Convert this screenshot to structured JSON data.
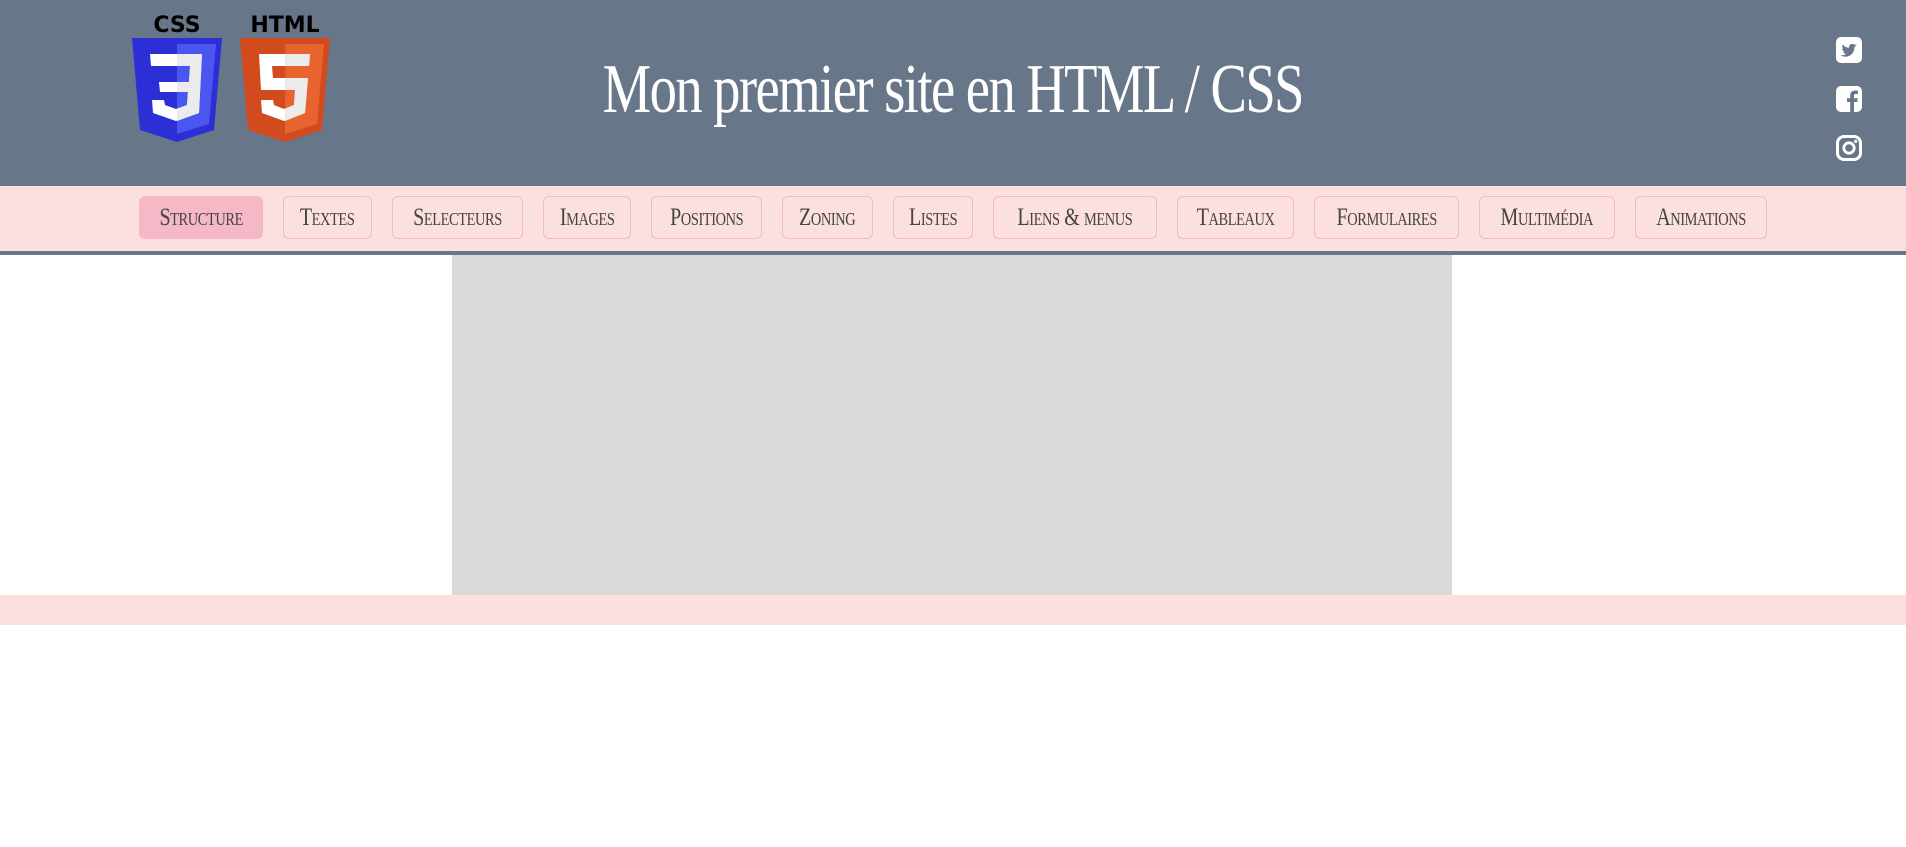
{
  "header": {
    "title": "Mon premier site en HTML / CSS",
    "logos": [
      {
        "name": "css3-logo",
        "caption": "CSS",
        "digit": "3",
        "colors": {
          "dark": "#2c2fd6",
          "light": "#4a56ef",
          "text": "#000000"
        }
      },
      {
        "name": "html5-logo",
        "caption": "HTML",
        "digit": "5",
        "colors": {
          "dark": "#d24b1f",
          "light": "#e8632e",
          "text": "#000000"
        }
      }
    ],
    "social": [
      "twitter-icon",
      "facebook-icon",
      "instagram-icon"
    ]
  },
  "nav": {
    "items": [
      {
        "label": "Structure",
        "active": true
      },
      {
        "label": "Textes"
      },
      {
        "label": "Selecteurs"
      },
      {
        "label": "Images"
      },
      {
        "label": "Positions"
      },
      {
        "label": "Zoning"
      },
      {
        "label": "Listes"
      },
      {
        "label": "Liens & menus"
      },
      {
        "label": "Tableaux"
      },
      {
        "label": "Formulaires"
      },
      {
        "label": "Multimédia"
      },
      {
        "label": "Animations"
      }
    ]
  },
  "colors": {
    "header_bg": "#68768a",
    "nav_bg": "#fce0df",
    "nav_border": "#f5b8c0",
    "active_bg": "#f5b8c6",
    "placeholder_bg": "#d9d9d9",
    "footer_bg": "#fce0df"
  }
}
